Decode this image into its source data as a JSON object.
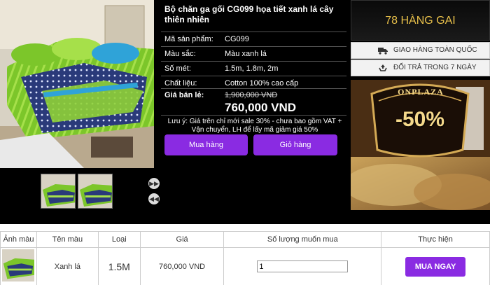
{
  "product": {
    "title": "Bộ chăn ga gối CG099 họa tiết xanh lá cây thiên nhiên",
    "specs": [
      {
        "label": "Mã sản phẩm:",
        "value": "CG099"
      },
      {
        "label": "Màu sắc:",
        "value": "Màu xanh lá"
      },
      {
        "label": "Số mét:",
        "value": "1.5m, 1.8m, 2m"
      },
      {
        "label": "Chất liệu:",
        "value": "Cotton 100% cao cấp"
      }
    ],
    "price_label": "Giá bán lẻ:",
    "old_price": "1,900,000 VND",
    "new_price": "760,000 VND",
    "note": "Lưu ý: Giá trên chỉ mới sale 30% - chưa bao gồm VAT + Vận chuyển, LH để lấy mã giảm giá 50%",
    "buttons": {
      "buy": "Mua hàng",
      "cart": "Giỏ hàng"
    }
  },
  "sidebar": {
    "hotline": "78 HÀNG GAI",
    "services": [
      {
        "icon": "truck-icon",
        "label": "GIAO HÀNG TOÀN QUỐC"
      },
      {
        "icon": "recycle-icon",
        "label": "ĐỔI TRẢ TRONG 7 NGÀY"
      }
    ],
    "banner": {
      "brand": "ONPLAZA",
      "discount": "-50%"
    }
  },
  "order_table": {
    "headers": [
      "Ảnh màu",
      "Tên màu",
      "Loại",
      "Giá",
      "Số lượng muốn mua",
      "Thực hiện"
    ],
    "row": {
      "color_name": "Xanh lá",
      "type": "1.5M",
      "price": "760,000 VND",
      "quantity": "1",
      "action": "MUA NGAY"
    }
  },
  "colors": {
    "accent": "#8a2be2",
    "gold": "#e8c04a",
    "bedding_green": "#7cc62a"
  }
}
